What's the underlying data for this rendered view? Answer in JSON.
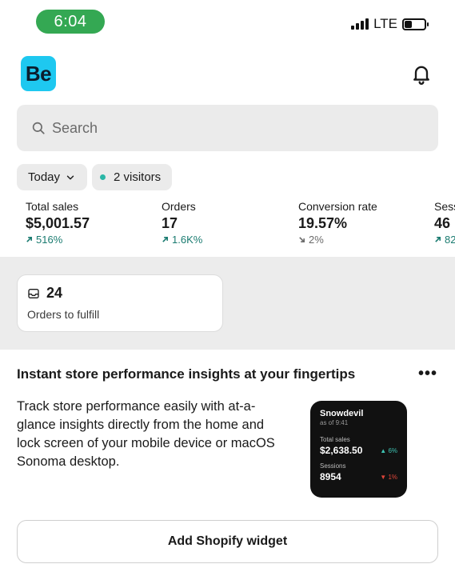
{
  "status_bar": {
    "time": "6:04",
    "network": "LTE"
  },
  "header": {
    "logo_text": "Be",
    "logo_color": "#1ec8f0"
  },
  "search": {
    "placeholder": "Search"
  },
  "filters": {
    "period_label": "Today",
    "visitors_label": "2 visitors"
  },
  "metrics": [
    {
      "label": "Total sales",
      "value": "$5,001.57",
      "change": "516%",
      "direction": "up"
    },
    {
      "label": "Orders",
      "value": "17",
      "change": "1.6K%",
      "direction": "up"
    },
    {
      "label": "Conversion rate",
      "value": "19.57%",
      "change": "2%",
      "direction": "down"
    },
    {
      "label": "Sess",
      "value": "46",
      "change": "82",
      "direction": "up"
    }
  ],
  "fulfill": {
    "count": "24",
    "label": "Orders to fulfill"
  },
  "insight": {
    "title": "Instant store performance insights at your fingertips",
    "body": "Track store performance easily with at-a-glance insights directly from the home and lock screen of your mobile device or macOS Sonoma desktop.",
    "more": "•••"
  },
  "widget": {
    "store": "Snowdevil",
    "as_of": "as of 9:41",
    "sales_label": "Total sales",
    "sales_value": "$2,638.50",
    "sales_change": "6%",
    "sessions_label": "Sessions",
    "sessions_value": "8954",
    "sessions_change": "1%"
  },
  "add_widget_button": "Add Shopify widget",
  "colors": {
    "accent_green": "#34a853",
    "positive": "#1a7b70",
    "widget_negative": "#e0453a"
  }
}
